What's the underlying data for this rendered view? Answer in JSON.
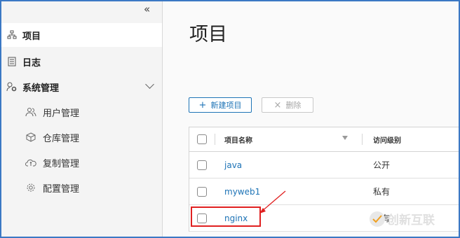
{
  "sidebar": {
    "collapse_glyph": "«",
    "items": [
      {
        "label": "项目",
        "icon": "project-tree-icon"
      },
      {
        "label": "日志",
        "icon": "log-icon"
      },
      {
        "label": "系统管理",
        "icon": "system-settings-icon"
      }
    ],
    "sub_items": [
      {
        "label": "用户管理",
        "icon": "users-icon"
      },
      {
        "label": "仓库管理",
        "icon": "box-icon"
      },
      {
        "label": "复制管理",
        "icon": "cloud-sync-icon"
      },
      {
        "label": "配置管理",
        "icon": "gear-icon"
      }
    ]
  },
  "main": {
    "title": "项目",
    "new_button": {
      "symbol": "+",
      "label": "新建项目"
    },
    "delete_button": {
      "symbol": "×",
      "label": "删除"
    },
    "table": {
      "columns": [
        "项目名称",
        "访问级别"
      ],
      "rows": [
        {
          "name": "java",
          "access": "公开"
        },
        {
          "name": "myweb1",
          "access": "私有"
        },
        {
          "name": "nginx",
          "access": "私有"
        }
      ]
    }
  },
  "watermark": {
    "text": "创新互联"
  },
  "colors": {
    "accent": "#1d73b6",
    "highlight": "#e02020",
    "frame": "#3b78c4"
  }
}
